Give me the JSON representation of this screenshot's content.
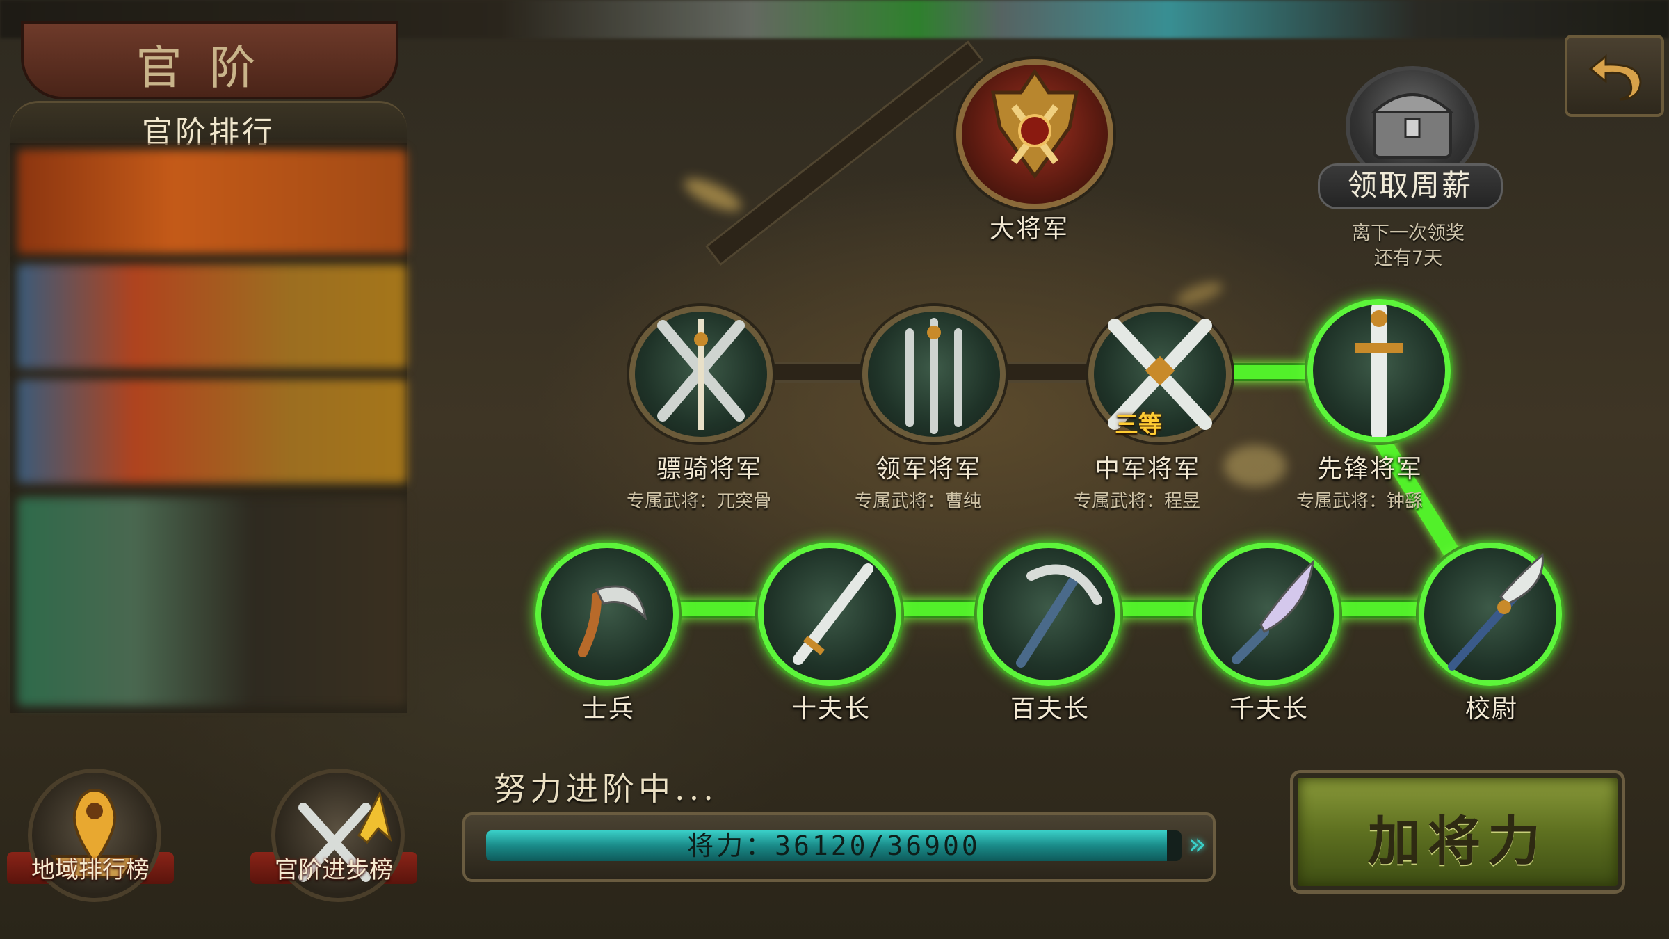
{
  "header": {
    "title": "官阶"
  },
  "ranking_panel": {
    "title": "官阶排行"
  },
  "ranks_upper": [
    {
      "name": "骠骑将军",
      "exclusive_general": "专属武将：兀突骨",
      "icon": "crossed-swords-emblem-icon"
    },
    {
      "name": "领军将军",
      "exclusive_general": "专属武将：曹纯",
      "icon": "triple-swords-emblem-icon"
    },
    {
      "name": "中军将军",
      "exclusive_general": "专属武将：程昱",
      "icon": "crossed-swords-icon",
      "tier": "三等"
    },
    {
      "name": "先锋将军",
      "exclusive_general": "专属武将：钟繇",
      "icon": "single-sword-icon"
    }
  ],
  "rank_top": {
    "name": "大将军",
    "icon": "battle-axe-shield-icon"
  },
  "ranks_lower": [
    {
      "name": "士兵",
      "icon": "sickle-icon"
    },
    {
      "name": "十夫长",
      "icon": "dagger-icon"
    },
    {
      "name": "百夫长",
      "icon": "pickaxe-icon"
    },
    {
      "name": "千夫长",
      "icon": "saber-icon"
    },
    {
      "name": "校尉",
      "icon": "glaive-icon"
    }
  ],
  "weekly_reward": {
    "button_label": "领取周薪",
    "note_line1": "离下一次领奖",
    "note_line2": "还有7天"
  },
  "bottom_buttons": [
    {
      "label": "地域排行榜",
      "icon": "map-pin-icon"
    },
    {
      "label": "官阶进步榜",
      "icon": "swords-up-arrow-icon"
    }
  ],
  "progress": {
    "caption": "努力进阶中...",
    "label": "将力：36120/36900",
    "current": 36120,
    "max": 36900
  },
  "action_button": {
    "label": "加将力"
  },
  "colors": {
    "active_path": "#52f02a",
    "progress_fill": "#2aaea8",
    "button_green": "#6e8028"
  }
}
